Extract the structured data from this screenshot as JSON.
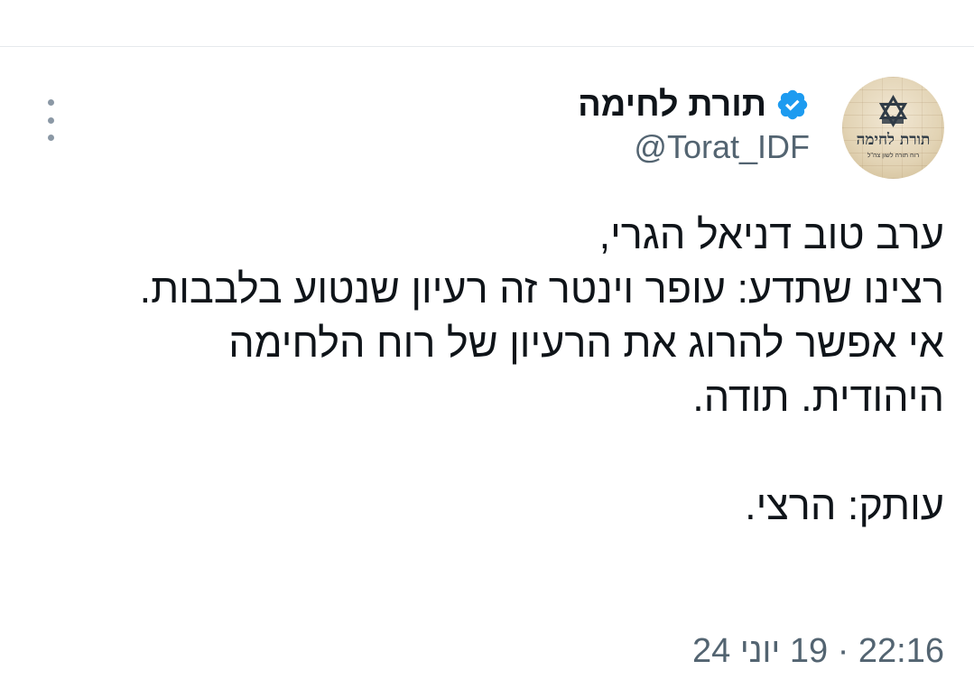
{
  "tweet": {
    "author": {
      "display_name": "תורת לחימה",
      "handle": "@Torat_IDF",
      "verified": true,
      "avatar_text": "תורת לחימה",
      "avatar_subtext": "רוח תורה לשון צה\"ל"
    },
    "text_lines": [
      "ערב טוב דניאל הגרי,",
      "רצינו שתדע: עופר וינטר זה רעיון שנטוע בלבבות.",
      "אי אפשר להרוג את הרעיון של רוח הלחימה",
      "היהודית. תודה.",
      "",
      "עותק: הרצי."
    ],
    "time": "22:16",
    "separator": "·",
    "date": "19 יוני 24"
  },
  "icons": {
    "verified": "verified-badge-icon",
    "more": "more-vertical-icon"
  },
  "colors": {
    "verified": "#1d9bf0",
    "secondary_text": "#536471",
    "primary_text": "#0f1419"
  }
}
